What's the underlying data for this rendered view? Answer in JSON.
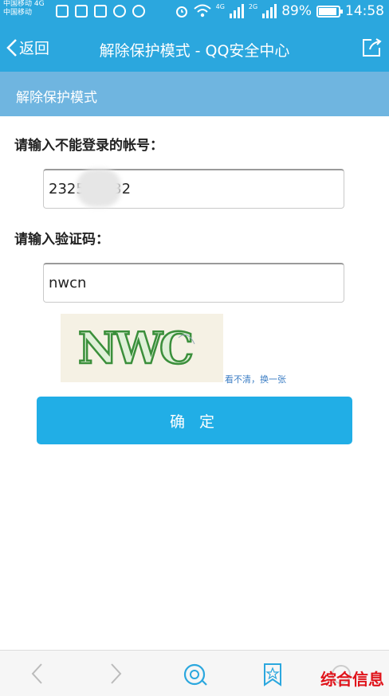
{
  "status_bar": {
    "carrier_line1": "中国移动 4G",
    "carrier_line2": "中国移动",
    "net_a": "4G",
    "net_b": "2G",
    "battery": "89%",
    "time": "14:58"
  },
  "nav": {
    "back_label": "返回",
    "title": "解除保护模式 - QQ安全中心"
  },
  "section_header": "解除保护模式",
  "form": {
    "account_label": "请输入不能登录的帐号：",
    "account_value": "2325      32",
    "captcha_label": "请输入验证码：",
    "captcha_value": "nwcn",
    "captcha_image_text": "NWC",
    "refresh_link": "看不清，换一张",
    "confirm_label": "确 定"
  },
  "watermark": "综合信息",
  "colors": {
    "header_blue": "#2ba7de",
    "section_blue": "#6fb5e0",
    "button_blue": "#21aee6",
    "captcha_green": "#3b8f3b",
    "watermark_red": "#e0141b"
  }
}
